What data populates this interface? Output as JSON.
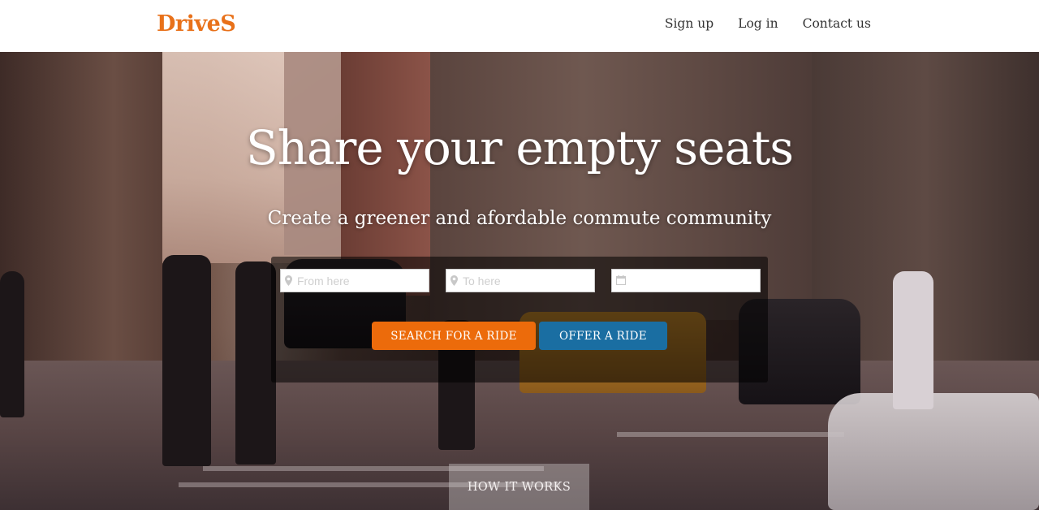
{
  "navbar": {
    "brand": "DriveS",
    "links": [
      {
        "label": "Sign up"
      },
      {
        "label": "Log in"
      },
      {
        "label": "Contact us"
      }
    ]
  },
  "hero": {
    "title": "Share your empty seats",
    "subtitle": "Create a greener and afordable commute community",
    "search": {
      "from_placeholder": "From here",
      "to_placeholder": "To here",
      "date_placeholder": "",
      "from_icon": "map-marker-icon",
      "to_icon": "map-marker-icon",
      "date_icon": "calendar-icon",
      "search_label": "Search for a ride",
      "offer_label": "Offer a ride"
    },
    "how_it_works_label": "HOW IT WORKS"
  },
  "colors": {
    "brand": "#e8711a",
    "search_button": "#ec6b0b",
    "offer_button": "#1a6ea2"
  }
}
